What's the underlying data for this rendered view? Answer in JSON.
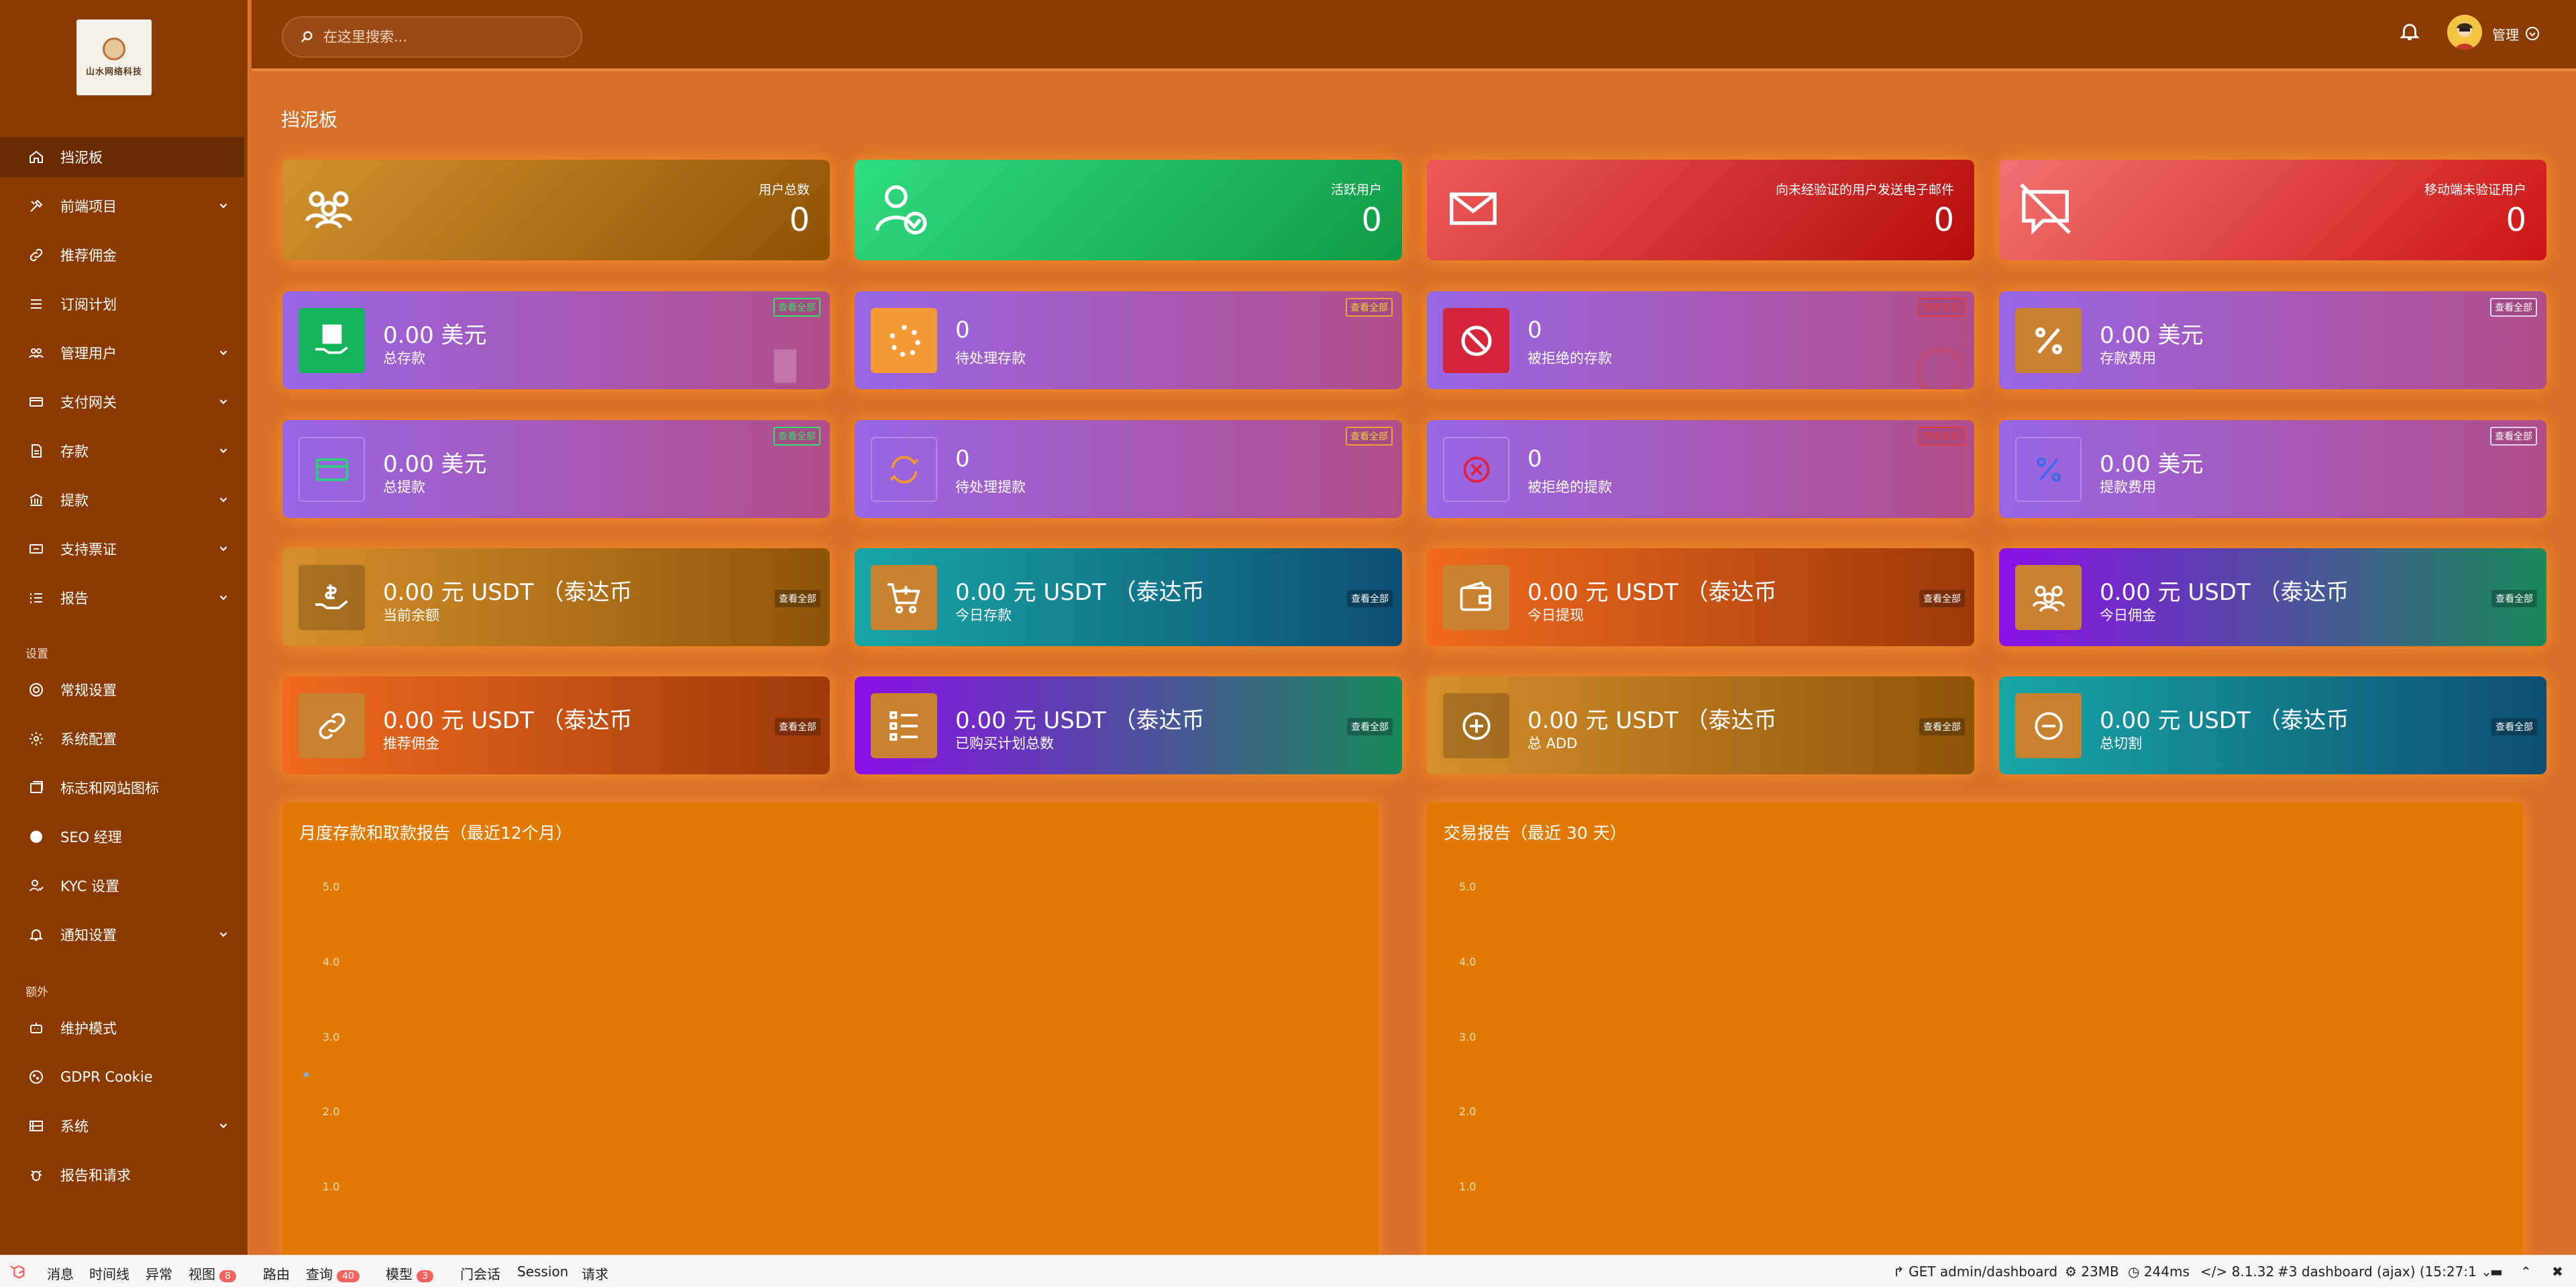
{
  "logo": {
    "text": "山水网络科技"
  },
  "header": {
    "search_placeholder": "在这里搜索...",
    "username": "管理"
  },
  "sidebar": {
    "items": [
      {
        "label": "挡泥板"
      },
      {
        "label": "前端项目"
      },
      {
        "label": "推荐佣金"
      },
      {
        "label": "订阅计划"
      },
      {
        "label": "管理用户"
      },
      {
        "label": "支付网关"
      },
      {
        "label": "存款"
      },
      {
        "label": "提款"
      },
      {
        "label": "支持票证"
      },
      {
        "label": "报告"
      }
    ],
    "section_settings": "设置",
    "settings_items": [
      {
        "label": "常规设置"
      },
      {
        "label": "系统配置"
      },
      {
        "label": "标志和网站图标"
      },
      {
        "label": "SEO 经理"
      },
      {
        "label": "KYC 设置"
      },
      {
        "label": "通知设置"
      }
    ],
    "section_extra": "额外",
    "extra_items": [
      {
        "label": "维护模式"
      },
      {
        "label": "GDPR Cookie"
      },
      {
        "label": "系统"
      },
      {
        "label": "报告和请求"
      }
    ]
  },
  "main": {
    "title": "挡泥板",
    "row1": [
      {
        "label": "用户总数",
        "value": "0"
      },
      {
        "label": "活跃用户",
        "value": "0"
      },
      {
        "label": "向未经验证的用户发送电子邮件",
        "value": "0"
      },
      {
        "label": "移动端未验证用户",
        "value": "0"
      }
    ],
    "row2": [
      {
        "value": "0.00 美元",
        "label": "总存款",
        "badge": "查看全部"
      },
      {
        "value": "0",
        "label": "待处理存款",
        "badge": "查看全部"
      },
      {
        "value": "0",
        "label": "被拒绝的存款",
        "badge": "查看全部"
      },
      {
        "value": "0.00 美元",
        "label": "存款费用",
        "badge": "查看全部"
      }
    ],
    "row3": [
      {
        "value": "0.00 美元",
        "label": "总提款",
        "badge": "查看全部"
      },
      {
        "value": "0",
        "label": "待处理提款",
        "badge": "查看全部"
      },
      {
        "value": "0",
        "label": "被拒绝的提款",
        "badge": "查看全部"
      },
      {
        "value": "0.00 美元",
        "label": "提款费用",
        "badge": "查看全部"
      }
    ],
    "row4": [
      {
        "value": "0.00 元 USDT （泰达币",
        "label": "当前余额",
        "badge": "查看全部"
      },
      {
        "value": "0.00 元 USDT （泰达币",
        "label": "今日存款",
        "badge": "查看全部"
      },
      {
        "value": "0.00 元 USDT （泰达币",
        "label": "今日提现",
        "badge": "查看全部"
      },
      {
        "value": "0.00 元 USDT （泰达币",
        "label": "今日佣金",
        "badge": "查看全部"
      }
    ],
    "row5": [
      {
        "value": "0.00 元 USDT （泰达币",
        "label": "推荐佣金",
        "badge": "查看全部"
      },
      {
        "value": "0.00 元 USDT （泰达币",
        "label": "已购买计划总数",
        "badge": "查看全部"
      },
      {
        "value": "0.00 元 USDT （泰达币",
        "label": "总 ADD",
        "badge": "查看全部"
      },
      {
        "value": "0.00 元 USDT （泰达币",
        "label": "总切割",
        "badge": "查看全部"
      }
    ]
  },
  "chart_data": [
    {
      "type": "line",
      "title": "月度存款和取款报告（最近12个月）",
      "yticks": [
        "5.0",
        "4.0",
        "3.0",
        "2.0",
        "1.0"
      ],
      "ylim": [
        0,
        5
      ]
    },
    {
      "type": "line",
      "title": "交易报告（最近 30 天）",
      "yticks": [
        "5.0",
        "4.0",
        "3.0",
        "2.0",
        "1.0"
      ],
      "ylim": [
        0,
        5
      ]
    }
  ],
  "debugbar": {
    "tabs": [
      "消息",
      "时间线",
      "异常",
      "视图",
      "路由",
      "查询",
      "模型",
      "门会话",
      "Session",
      "请求"
    ],
    "views_count": "8",
    "queries_count": "40",
    "models_count": "3",
    "route": "GET admin/dashboard",
    "memory": "23MB",
    "time": "244ms",
    "php": "8.1.32",
    "request": "#3 dashboard (ajax) (15:27:1"
  },
  "colors": {
    "sidebar": "#8a3a02",
    "header": "#8b3c02",
    "background": "#d9702a",
    "panel": "#e17902"
  }
}
